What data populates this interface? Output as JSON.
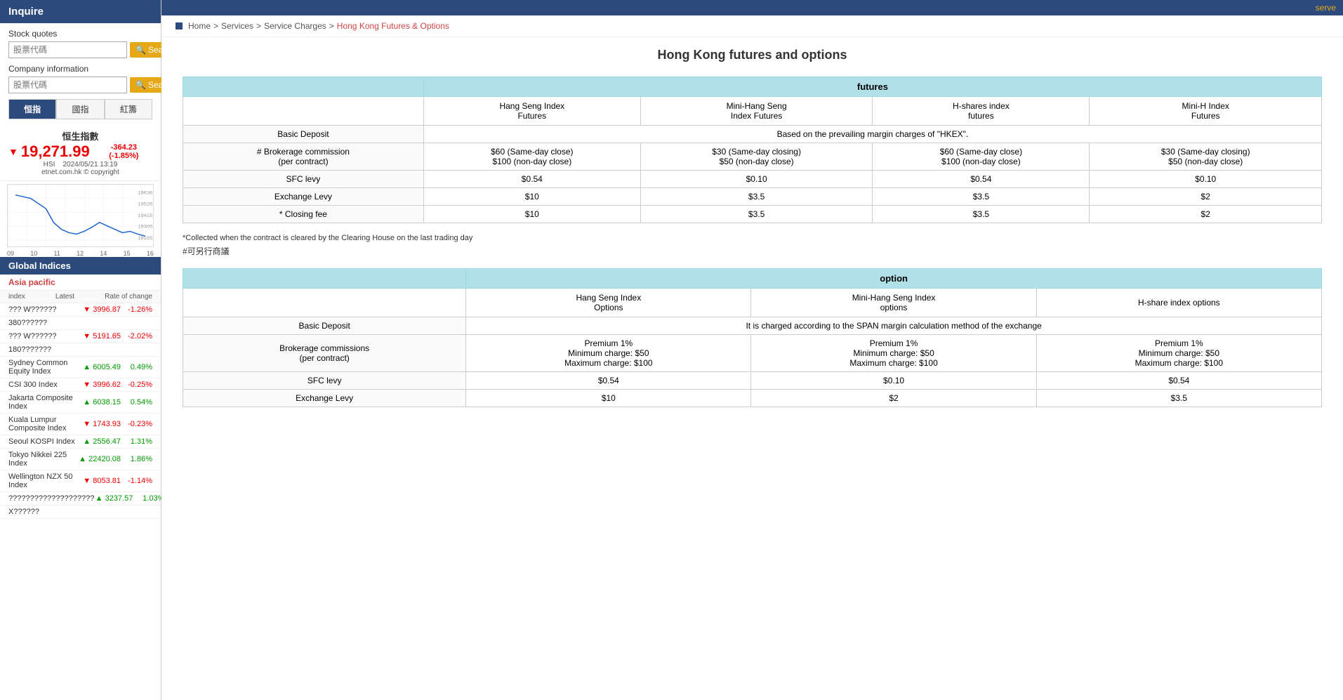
{
  "sidebar": {
    "inquire_label": "Inquire",
    "stock_quotes_label": "Stock quotes",
    "stock_quotes_placeholder": "股票代碼",
    "company_info_label": "Company information",
    "company_info_placeholder": "股票代碼",
    "search_btn": "Search",
    "tabs": [
      "恒指",
      "國指",
      "紅籌"
    ],
    "hsi_section": {
      "title": "恒生指數",
      "value": "19,271.99",
      "change": "-364.23 (-1.85%)",
      "hsi_label": "HSI",
      "date": "2024/05/21 13:19",
      "copyright": "etnet.com.hk © copyright"
    },
    "chart_x_labels": [
      "09",
      "10",
      "11",
      "12",
      "14",
      "15",
      "16"
    ],
    "chart_y_labels": [
      "19636",
      "19526",
      "19415",
      "19305",
      "19195"
    ],
    "global_indices": {
      "section_title": "Global Indices",
      "region": "Asia pacific",
      "header_index": "index",
      "header_latest": "Latest",
      "header_rate": "Rate of change",
      "rows": [
        {
          "name": "??? W??????",
          "value": "3996.87",
          "change": "-1.26%",
          "dir": "down"
        },
        {
          "name": "380??????",
          "value": "",
          "change": "",
          "dir": ""
        },
        {
          "name": "??? W??????",
          "value": "5191.65",
          "change": "-2.02%",
          "dir": "down"
        },
        {
          "name": "180???????",
          "value": "",
          "change": "",
          "dir": ""
        },
        {
          "name": "Sydney Common Equity Index",
          "value": "6005.49",
          "change": "0.49%",
          "dir": "up"
        },
        {
          "name": "CSI 300 Index",
          "value": "3996.62",
          "change": "-0.25%",
          "dir": "down"
        },
        {
          "name": "Jakarta Composite Index",
          "value": "6038.15",
          "change": "0.54%",
          "dir": "up"
        },
        {
          "name": "Kuala Lumpur Composite Index",
          "value": "1743.93",
          "change": "-0.23%",
          "dir": "down"
        },
        {
          "name": "Seoul KOSPI Index",
          "value": "2556.47",
          "change": "1.31%",
          "dir": "up"
        },
        {
          "name": "Tokyo Nikkei 225 Index",
          "value": "22420.08",
          "change": "1.86%",
          "dir": "up"
        },
        {
          "name": "Wellington NZX 50 Index",
          "value": "8053.81",
          "change": "-1.14%",
          "dir": "down"
        },
        {
          "name": "????????????????????",
          "value": "3237.57",
          "change": "1.03%",
          "dir": "up"
        },
        {
          "name": "X??????",
          "value": "",
          "change": "",
          "dir": ""
        }
      ]
    }
  },
  "nav": {
    "serve_link": "serve"
  },
  "breadcrumb": {
    "home": "Home",
    "services": "Services",
    "service_charges": "Service Charges",
    "current": "Hong Kong Futures & Options"
  },
  "page_title": "Hong Kong futures and options",
  "futures_table": {
    "section_header": "futures",
    "columns": [
      "Hang Seng Index Futures",
      "Mini-Hang Seng Index Futures",
      "H-shares index futures",
      "Mini-H Index Futures"
    ],
    "rows": [
      {
        "label": "Basic Deposit",
        "cells": [
          "Based on the prevailing margin charges of \"HKEX\"."
        ]
      },
      {
        "label": "# Brokerage commission (per contract)",
        "cells": [
          "$60 (Same-day close)\n$100 (non-day close)",
          "$30 (Same-day closing)\n$50 (non-day close)",
          "$60 (Same-day close)\n$100 (non-day close)",
          "$30 (Same-day closing)\n$50 (non-day close)"
        ]
      },
      {
        "label": "SFC levy",
        "cells": [
          "$0.54",
          "$0.10",
          "$0.54",
          "$0.10"
        ]
      },
      {
        "label": "Exchange Levy",
        "cells": [
          "$10",
          "$3.5",
          "$3.5",
          "$2"
        ]
      },
      {
        "label": "* Closing fee",
        "cells": [
          "$10",
          "$3.5",
          "$3.5",
          "$2"
        ]
      }
    ],
    "footnote1": "*Collected when the contract is cleared by the Clearing House on the last trading day",
    "footnote2": "#可另行商議"
  },
  "options_table": {
    "section_header": "option",
    "columns": [
      "Hang Seng Index Options",
      "Mini-Hang Seng Index options",
      "H-share index options"
    ],
    "rows": [
      {
        "label": "Basic Deposit",
        "cells": [
          "It is charged according to the SPAN margin calculation method of the exchange"
        ]
      },
      {
        "label": "Brokerage commissions (per contract)",
        "cells": [
          "Premium 1%\nMinimum charge: $50\nMaximum charge: $100",
          "Premium 1%\nMinimum charge: $50\nMaximum charge: $100",
          "Premium 1%\nMinimum charge: $50\nMaximum charge: $100"
        ]
      },
      {
        "label": "SFC levy",
        "cells": [
          "$0.54",
          "$0.10",
          "$0.54"
        ]
      },
      {
        "label": "Exchange Levy",
        "cells": [
          "$10",
          "$2",
          "$3.5"
        ]
      }
    ]
  }
}
